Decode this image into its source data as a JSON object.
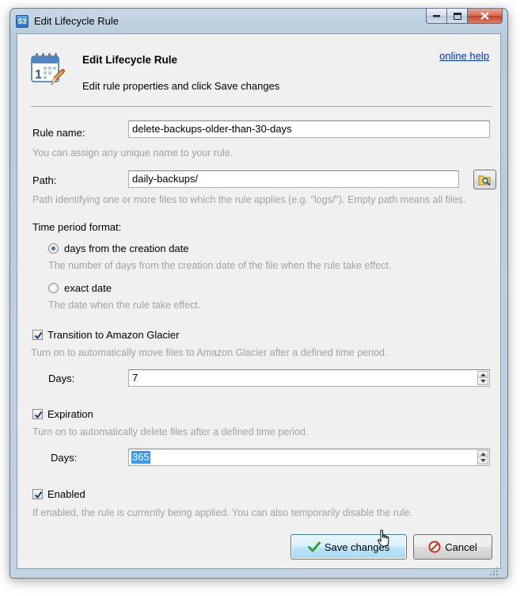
{
  "window": {
    "title": "Edit Lifecycle Rule",
    "app_badge": "S3"
  },
  "header": {
    "title": "Edit Lifecycle Rule",
    "subtitle": "Edit rule properties and click Save changes",
    "help_link": "online help"
  },
  "rule_name": {
    "label": "Rule name:",
    "value": "delete-backups-older-than-30-days",
    "hint": "You can assign any unique name to your rule."
  },
  "path": {
    "label": "Path:",
    "value": "daily-backups/",
    "hint": "Path identifying one or more files to which the rule applies (e.g. \"logs/\"). Empty path means all files."
  },
  "time_period": {
    "label": "Time period format:",
    "options": [
      {
        "label": "days from the creation date",
        "hint": "The number of days from the creation date of the file when the rule take effect.",
        "checked": true
      },
      {
        "label": "exact date",
        "hint": "The date when the rule take effect.",
        "checked": false
      }
    ]
  },
  "glacier": {
    "label": "Transition to Amazon Glacier",
    "checked": true,
    "hint": "Turn on to automatically move files to Amazon Glacier after a defined time period.",
    "days_label": "Days:",
    "days_value": "7"
  },
  "expiration": {
    "label": "Expiration",
    "checked": true,
    "hint": "Turn on to automatically delete files after a defined time period.",
    "days_label": "Days:",
    "days_value": "365"
  },
  "enabled": {
    "label": "Enabled",
    "checked": true,
    "hint": "If enabled, the rule is currently being applied. You can also temporarily disable the rule."
  },
  "buttons": {
    "save": "Save changes",
    "cancel": "Cancel"
  }
}
